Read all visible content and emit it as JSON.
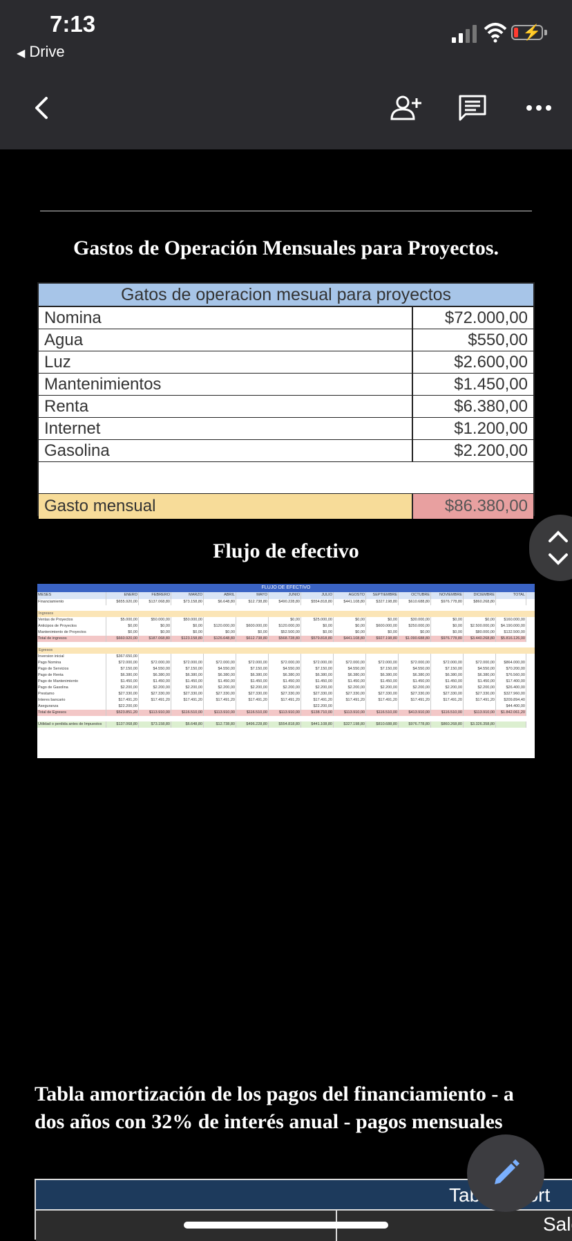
{
  "status_bar": {
    "time": "7:13",
    "back_app": "Drive"
  },
  "toolbar": {
    "back": "back",
    "add_person": "add-person",
    "comments": "comments",
    "more": "more"
  },
  "doc": {
    "section1_title": "Gastos de Operación Mensuales para Proyectos.",
    "expense_table": {
      "header": "Gatos de operacion mesual para proyectos",
      "rows": [
        {
          "label": "Nomina",
          "value": "$72.000,00"
        },
        {
          "label": "Agua",
          "value": "$550,00"
        },
        {
          "label": "Luz",
          "value": "$2.600,00"
        },
        {
          "label": "Mantenimientos",
          "value": "$1.450,00"
        },
        {
          "label": "Renta",
          "value": "$6.380,00"
        },
        {
          "label": "Internet",
          "value": "$1.200,00"
        },
        {
          "label": "Gasolina",
          "value": "$2.200,00"
        }
      ],
      "total_label": "Gasto mensual",
      "total_value": "$86.380,00"
    },
    "section2_title": "Flujo de efectivo",
    "cash_flow": {
      "title": "FLUJO DE EFECTIVO",
      "months": [
        "MESES",
        "ENERO",
        "FEBRERO",
        "MARZO",
        "ABRIL",
        "MAYO",
        "JUNIO",
        "JULIO",
        "AGOSTO",
        "SEPTIEMBRE",
        "OCTUBRE",
        "NOVIEMBRE",
        "DICIEMBRE",
        "TOTAL"
      ],
      "financing": [
        "Financiamiento",
        "$655.920,00",
        "$137.068,80",
        "$73.158,80",
        "$6.648,80",
        "$12.738,80",
        "$490.228,80",
        "$554.818,80",
        "$441.108,80",
        "$327.198,80",
        "$610.688,80",
        "$976.778,80",
        "$860.268,80",
        ""
      ],
      "income_label": "Ingresos",
      "income_rows": [
        [
          "Ventas de Proyectos",
          "$5.000,00",
          "$50.000,00",
          "$50.000,00",
          "",
          "",
          "$0,00",
          "$25.000,00",
          "$0,00",
          "$0,00",
          "$30.000,00",
          "$0,00",
          "$0,00",
          "$160.000,00"
        ],
        [
          "Anticipos de Proyectos",
          "$0,00",
          "$0,00",
          "$0,00",
          "$120.000,00",
          "$600.000,00",
          "$120.000,00",
          "$0,00",
          "$0,00",
          "$600.000,00",
          "$250.000,00",
          "$0,00",
          "$2.500.000,00",
          "$4.190.000,00"
        ],
        [
          "Mantenimiento de Proyectos",
          "$0,00",
          "$0,00",
          "$0,00",
          "$0,00",
          "$0,00",
          "$52.500,00",
          "$0,00",
          "$0,00",
          "$0,00",
          "$0,00",
          "$0,00",
          "$80.000,00",
          "$132.500,00"
        ],
        [
          "Total de ingresos",
          "$660.920,00",
          "$187.068,80",
          "$123.158,80",
          "$126.648,80",
          "$612.738,80",
          "$568.728,80",
          "$579.818,80",
          "$441.108,80",
          "$927.198,80",
          "$1.090.688,80",
          "$976.778,80",
          "$3.440.268,80",
          "$5.816.126,00"
        ]
      ],
      "expense_label": "Egresos",
      "expense_rows": [
        [
          "Inversion inicial",
          "$367.650,00",
          "",
          "",
          "",
          "",
          "",
          "",
          "",
          "",
          "",
          "",
          "",
          ""
        ],
        [
          "Pago Nomina",
          "$72.000,00",
          "$72.000,00",
          "$72.000,00",
          "$72.000,00",
          "$72.000,00",
          "$72.000,00",
          "$72.000,00",
          "$72.000,00",
          "$72.000,00",
          "$72.000,00",
          "$72.000,00",
          "$72.000,00",
          "$864.000,00"
        ],
        [
          "Pago de Servicios",
          "$7.150,00",
          "$4.550,00",
          "$7.150,00",
          "$4.550,00",
          "$7.150,00",
          "$4.550,00",
          "$7.150,00",
          "$4.550,00",
          "$7.150,00",
          "$4.550,00",
          "$7.150,00",
          "$4.550,00",
          "$70.200,00"
        ],
        [
          "Pago de Renta",
          "$6.380,00",
          "$6.380,00",
          "$6.380,00",
          "$6.380,00",
          "$6.380,00",
          "$6.380,00",
          "$6.380,00",
          "$6.380,00",
          "$6.380,00",
          "$6.380,00",
          "$6.380,00",
          "$6.380,00",
          "$76.560,00"
        ],
        [
          "Pago de Mantenimiento",
          "$1.450,00",
          "$1.450,00",
          "$1.450,00",
          "$1.450,00",
          "$1.450,00",
          "$1.450,00",
          "$1.450,00",
          "$1.450,00",
          "$1.450,00",
          "$1.450,00",
          "$1.450,00",
          "$1.450,00",
          "$17.400,00"
        ],
        [
          "Pago de Gasolina",
          "$2.200,00",
          "$2.200,00",
          "$2.200,00",
          "$2.200,00",
          "$2.200,00",
          "$2.200,00",
          "$2.200,00",
          "$2.200,00",
          "$2.200,00",
          "$2.200,00",
          "$2.200,00",
          "$2.200,00",
          "$26.400,00"
        ],
        [
          "Prestamo",
          "$27.330,00",
          "$27.330,00",
          "$27.330,00",
          "$27.330,00",
          "$27.330,00",
          "$27.330,00",
          "$27.330,00",
          "$27.330,00",
          "$27.330,00",
          "$27.330,00",
          "$27.330,00",
          "$27.330,00",
          "$327.960,00"
        ],
        [
          "Interes bancario",
          "$17.491,20",
          "$17.491,20",
          "$17.491,20",
          "$17.491,20",
          "$17.491,20",
          "$17.491,20",
          "$17.491,20",
          "$17.491,20",
          "$17.491,20",
          "$17.491,20",
          "$17.491,20",
          "$17.491,20",
          "$209.894,40"
        ],
        [
          "Aseguranza",
          "$22.200,00",
          "",
          "",
          "",
          "",
          "",
          "$22.200,00",
          "",
          "",
          "",
          "",
          "",
          "$44.400,00"
        ],
        [
          "Total de Egresos",
          "$523.851,20",
          "$113.910,00",
          "$116.510,00",
          "$113.910,00",
          "$116.510,00",
          "$113.910,00",
          "$138.710,00",
          "$113.910,00",
          "$116.510,00",
          "$413.910,00",
          "$116.510,00",
          "$113.910,00",
          "$1.842.061,20"
        ]
      ],
      "profit_row": [
        "Utilidad o perdida antes de Impuestos",
        "$137.068,80",
        "$73.158,80",
        "$6.648,80",
        "$12.738,80",
        "$496.228,80",
        "$554.818,80",
        "$441.108,80",
        "$327.198,80",
        "$810.688,80",
        "$976.778,80",
        "$860.268,80",
        "$3.326.358,80",
        ""
      ]
    },
    "section3_title": "Tabla amortización de los pagos del financiamiento - a dos años con 32% de interés anual - pagos mensuales",
    "amort_header": "Tabla amort",
    "amort_col": "Saldo"
  },
  "colors": {
    "bar_bg": "#2b2b2f",
    "table_header": "#a7c5e8",
    "total_label_bg": "#f7dc99",
    "total_value_bg": "#e8a0a0"
  }
}
